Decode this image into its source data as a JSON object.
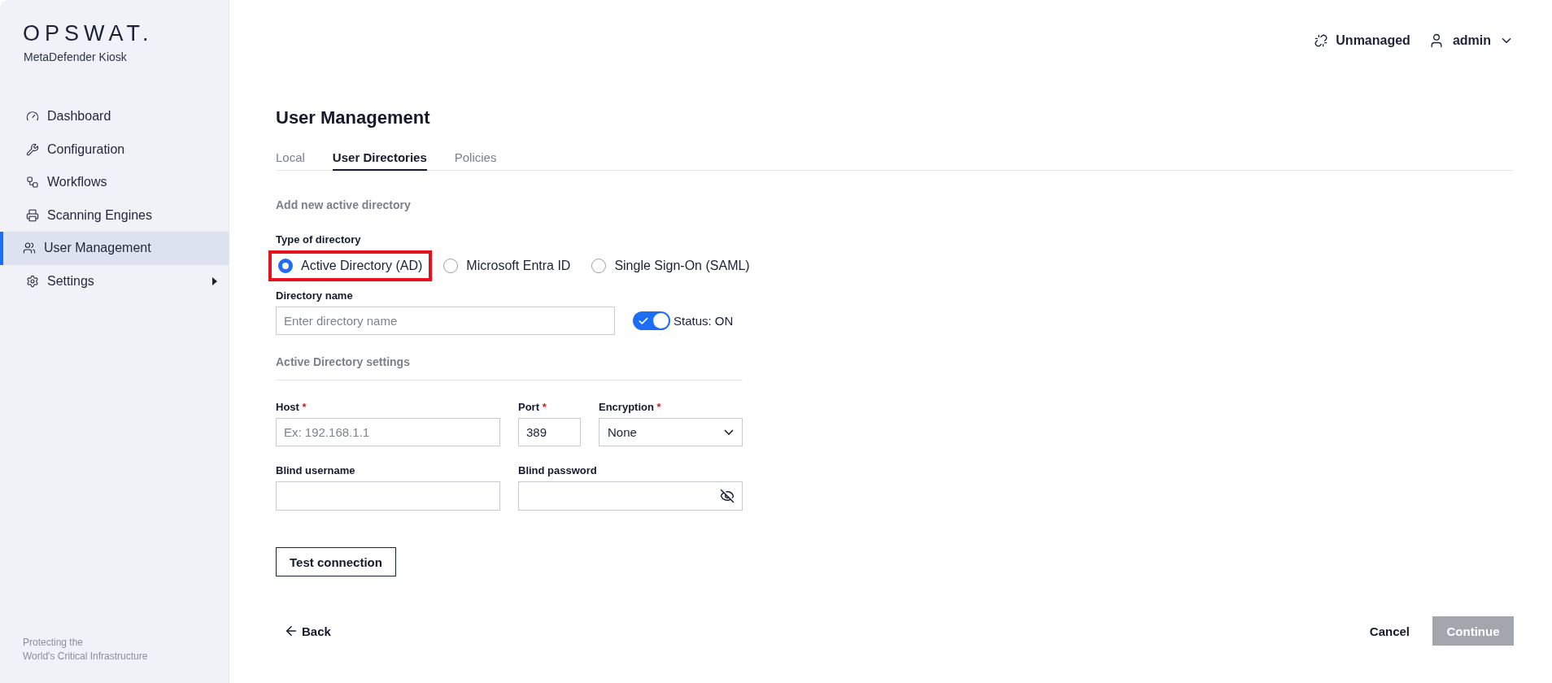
{
  "sidebar": {
    "logo": "OPSWAT.",
    "product": "MetaDefender Kiosk",
    "items": [
      {
        "label": "Dashboard",
        "selected": false,
        "has_submenu": false
      },
      {
        "label": "Configuration",
        "selected": false,
        "has_submenu": false
      },
      {
        "label": "Workflows",
        "selected": false,
        "has_submenu": false
      },
      {
        "label": "Scanning Engines",
        "selected": false,
        "has_submenu": false
      },
      {
        "label": "User Management",
        "selected": true,
        "has_submenu": false
      },
      {
        "label": "Settings",
        "selected": false,
        "has_submenu": true
      }
    ],
    "tagline": [
      "Protecting the",
      "World's Critical Infrastructure"
    ]
  },
  "header": {
    "status": "Unmanaged",
    "user": "admin"
  },
  "title": "User Management",
  "tabs": [
    {
      "label": "Local",
      "selected": false
    },
    {
      "label": "User Directories",
      "selected": true
    },
    {
      "label": "Policies",
      "selected": false
    }
  ],
  "form": {
    "heading": "Add new active directory",
    "type_label": "Type of directory",
    "types": [
      {
        "label": "Active Directory (AD)",
        "selected": true,
        "highlighted": true
      },
      {
        "label": "Microsoft Entra ID",
        "selected": false,
        "highlighted": false
      },
      {
        "label": "Single Sign-On (SAML)",
        "selected": false,
        "highlighted": false
      }
    ],
    "directory_name": {
      "label": "Directory name",
      "placeholder": "Enter directory name"
    },
    "status": {
      "label": "Status: ON",
      "on": true
    },
    "settings_heading": "Active Directory settings",
    "host": {
      "label": "Host",
      "required": true,
      "placeholder": "Ex: 192.168.1.1"
    },
    "port": {
      "label": "Port",
      "required": true,
      "value": "389"
    },
    "encryption": {
      "label": "Encryption",
      "required": true,
      "value": "None"
    },
    "blind_username": {
      "label": "Blind username",
      "required": false
    },
    "blind_password": {
      "label": "Blind password",
      "required": false
    },
    "test_button": "Test connection",
    "required_mark": "*"
  },
  "footer": {
    "back": "Back",
    "cancel": "Cancel",
    "continue": {
      "label": "Continue",
      "disabled": true
    }
  }
}
